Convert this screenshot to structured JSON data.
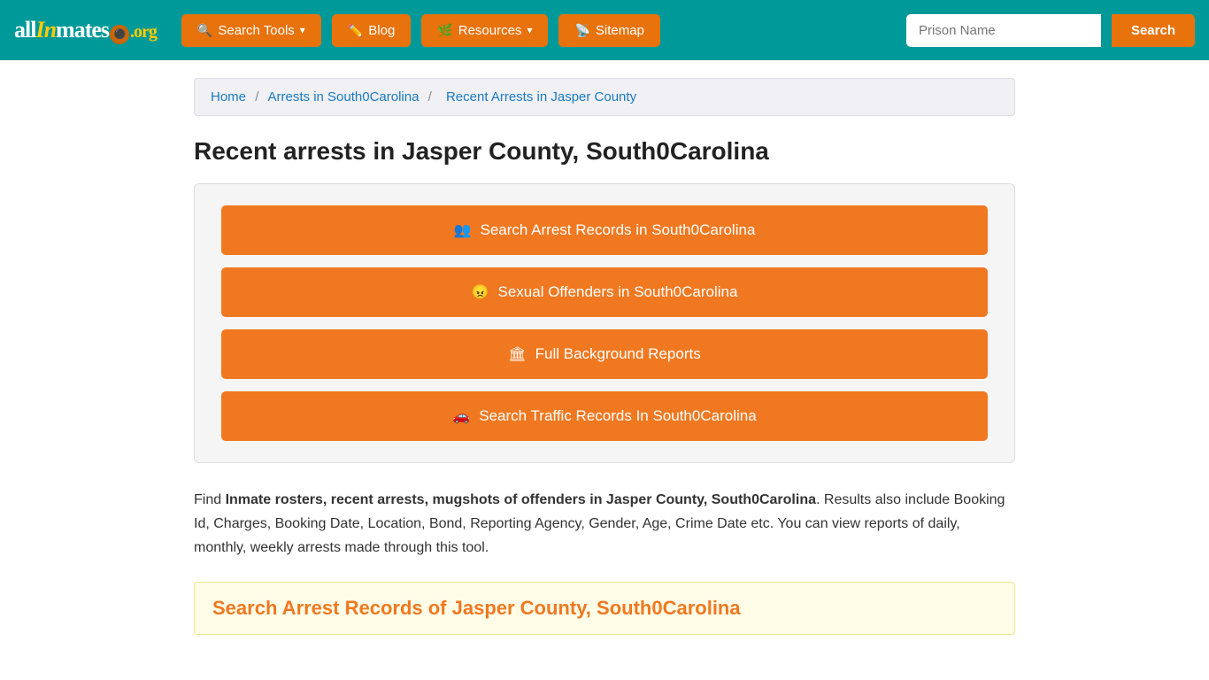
{
  "nav": {
    "logo": {
      "part1": "all",
      "part2": "In",
      "part3": "mates",
      "part4": ".org"
    },
    "buttons": [
      {
        "id": "search-tools",
        "label": "Search Tools",
        "hasDropdown": true
      },
      {
        "id": "blog",
        "label": "Blog",
        "hasDropdown": false
      },
      {
        "id": "resources",
        "label": "Resources",
        "hasDropdown": true
      },
      {
        "id": "sitemap",
        "label": "Sitemap",
        "hasDropdown": false
      }
    ],
    "search": {
      "placeholder": "Prison Name",
      "button_label": "Search"
    }
  },
  "breadcrumb": {
    "home": "Home",
    "arrests": "Arrests in South0Carolina",
    "current": "Recent Arrests in Jasper County"
  },
  "page": {
    "title": "Recent arrests in Jasper County, South0Carolina",
    "action_buttons": [
      {
        "id": "arrest-records",
        "label": "Search Arrest Records in South0Carolina",
        "icon": "people"
      },
      {
        "id": "sex-offenders",
        "label": "Sexual Offenders in South0Carolina",
        "icon": "angry"
      },
      {
        "id": "background-reports",
        "label": "Full Background Reports",
        "icon": "building"
      },
      {
        "id": "traffic-records",
        "label": "Search Traffic Records In South0Carolina",
        "icon": "car"
      }
    ],
    "description_prefix": "Find ",
    "description_bold": "Inmate rosters, recent arrests, mugshots of offenders in Jasper County, South0Carolina",
    "description_suffix": ". Results also include Booking Id, Charges, Booking Date, Location, Bond, Reporting Agency, Gender, Age, Crime Date etc. You can view reports of daily, monthly, weekly arrests made through this tool.",
    "section_heading": "Search Arrest Records of Jasper County, South0Carolina"
  }
}
